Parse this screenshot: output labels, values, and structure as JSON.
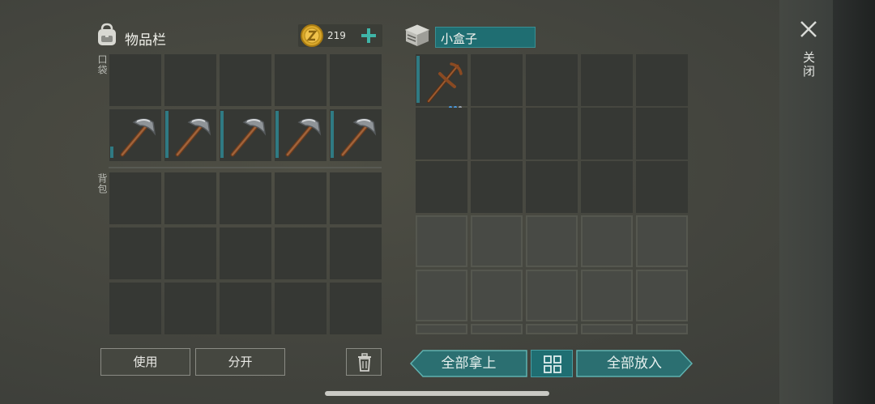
{
  "inventory": {
    "title": "物品栏",
    "coins": "219",
    "pocket_label": "口袋",
    "backpack_label": "背包",
    "pocket_items": [
      "",
      "",
      "",
      "",
      "",
      "pickaxe",
      "pickaxe",
      "pickaxe",
      "pickaxe",
      "pickaxe"
    ],
    "backpack_items": [
      "",
      "",
      "",
      "",
      "",
      "",
      "",
      "",
      "",
      "",
      "",
      "",
      "",
      "",
      ""
    ]
  },
  "container": {
    "name": "小盒子",
    "items": [
      "pickaxe-wood"
    ]
  },
  "close_label": "关闭",
  "buttons": {
    "use": "使用",
    "split": "分开",
    "take_all": "全部拿上",
    "put_all": "全部放入"
  },
  "colors": {
    "accent": "#1f6e72",
    "slot_bar": "#2f7a83",
    "coin": "#d9a72a"
  },
  "icons": [
    "backpack-icon",
    "coin-icon",
    "plus-icon",
    "box-icon",
    "close-icon",
    "trash-icon",
    "grid-icon",
    "pickaxe-icon"
  ]
}
